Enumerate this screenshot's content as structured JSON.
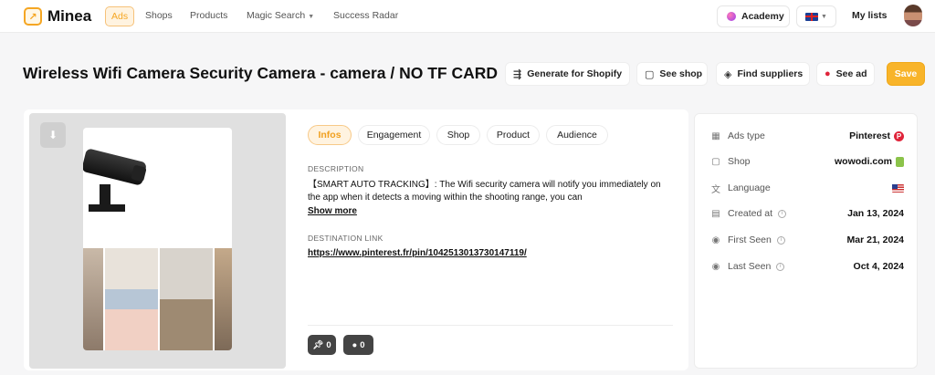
{
  "nav": {
    "brand": "Minea",
    "items": [
      "Ads",
      "Shops",
      "Products",
      "Magic Search",
      "Success Radar"
    ],
    "academy": "Academy",
    "my_lists": "My lists"
  },
  "title": "Wireless Wifi Camera Security Camera - camera / NO TF CARD",
  "actions": {
    "generate": "Generate for Shopify",
    "see_shop": "See shop",
    "find_suppliers": "Find suppliers",
    "see_ad": "See ad",
    "save": "Save"
  },
  "tabs": [
    "Infos",
    "Engagement",
    "Shop",
    "Product",
    "Audience"
  ],
  "content": {
    "description_label": "DESCRIPTION",
    "description": "【SMART AUTO TRACKING】: The Wifi security camera will notify you immediately on the app when it detects a moving within the shooting range, you can",
    "show_more": "Show more",
    "destination_label": "DESTINATION LINK",
    "destination_url": "https://www.pinterest.fr/pin/1042513013730147119/",
    "saves_count": "0",
    "comments_count": "0"
  },
  "details": [
    {
      "label": "Ads type",
      "value": "Pinterest"
    },
    {
      "label": "Shop",
      "value": "wowodi.com"
    },
    {
      "label": "Language",
      "value": ""
    },
    {
      "label": "Created at",
      "value": "Jan 13, 2024"
    },
    {
      "label": "First Seen",
      "value": "Mar 21, 2024"
    },
    {
      "label": "Last Seen",
      "value": "Oct 4, 2024"
    }
  ],
  "colors": {
    "accent": "#f5a623",
    "save_button": "#f8b42a",
    "pinterest": "#e0243a"
  },
  "icons": [
    "logo-icon",
    "academy-icon",
    "uk-flag-icon",
    "chevron-down-icon",
    "generate-icon",
    "shop-icon",
    "box-icon",
    "pinterest-icon",
    "download-icon",
    "pin-icon",
    "comment-icon",
    "grid-icon",
    "store-icon",
    "translate-icon",
    "calendar-icon",
    "eye-icon",
    "info-icon",
    "shopify-icon",
    "us-flag-icon"
  ]
}
